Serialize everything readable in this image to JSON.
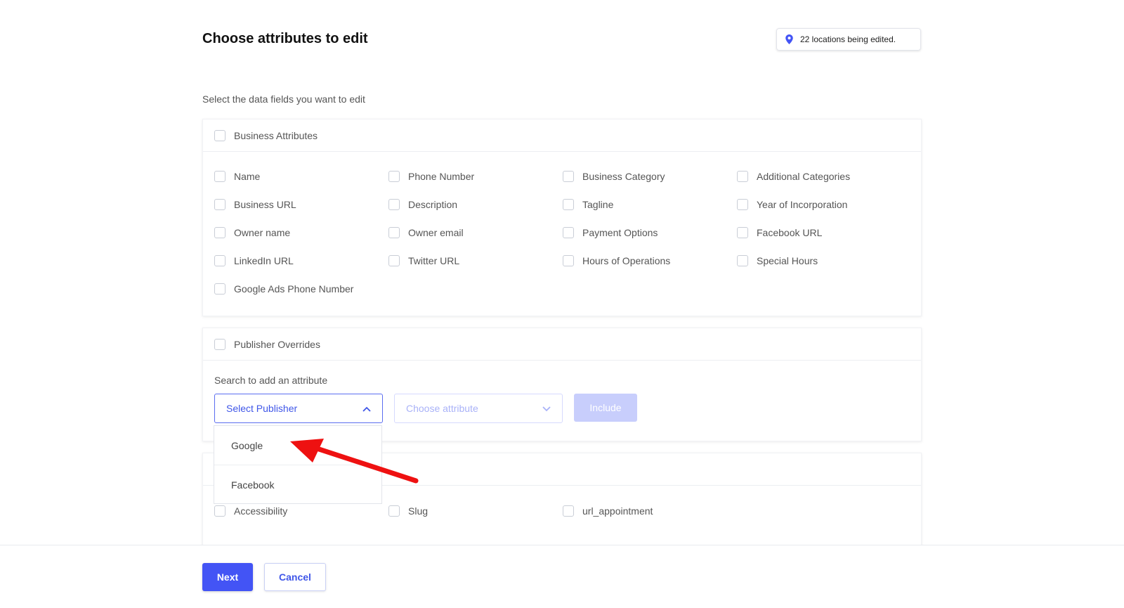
{
  "header": {
    "title": "Choose attributes to edit",
    "locations_badge": "22 locations being edited."
  },
  "subtitle": "Select the data fields you want to edit",
  "business_attributes": {
    "title": "Business Attributes",
    "items": [
      "Name",
      "Phone Number",
      "Business Category",
      "Additional Categories",
      "Business URL",
      "Description",
      "Tagline",
      "Year of Incorporation",
      "Owner name",
      "Owner email",
      "Payment Options",
      "Facebook URL",
      "LinkedIn URL",
      "Twitter URL",
      "Hours of Operations",
      "Special Hours",
      "Google Ads Phone Number"
    ]
  },
  "publisher_overrides": {
    "title": "Publisher Overrides",
    "search_label": "Search to add an attribute",
    "select_publisher": "Select Publisher",
    "choose_attribute": "Choose attribute",
    "include_label": "Include",
    "dropdown_options": [
      "Google",
      "Facebook"
    ]
  },
  "custom_attributes": {
    "items": [
      "Accessibility",
      "Slug",
      "url_appointment"
    ]
  },
  "footer": {
    "next_label": "Next",
    "cancel_label": "Cancel"
  },
  "colors": {
    "accent": "#4354f5",
    "annotation_arrow": "#ee1111"
  }
}
